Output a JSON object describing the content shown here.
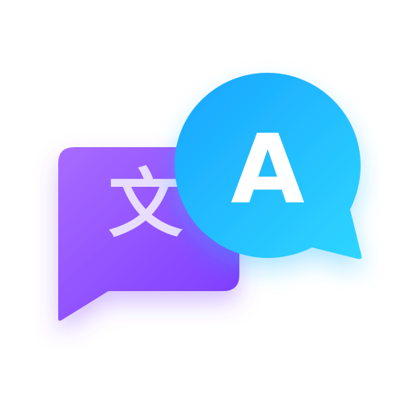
{
  "icon": {
    "source_bubble": {
      "glyph": "文",
      "icon_name": "chinese-character-bubble-icon",
      "gradient_start": "#A86BFF",
      "gradient_end": "#7B3BFF",
      "glyph_color": "#E9DDFF"
    },
    "target_bubble": {
      "glyph": "A",
      "icon_name": "latin-letter-bubble-icon",
      "gradient_start": "#18A4FF",
      "gradient_end": "#2ED6FF",
      "glyph_color": "#FFFFFF"
    },
    "meaning": "translate-icon"
  }
}
